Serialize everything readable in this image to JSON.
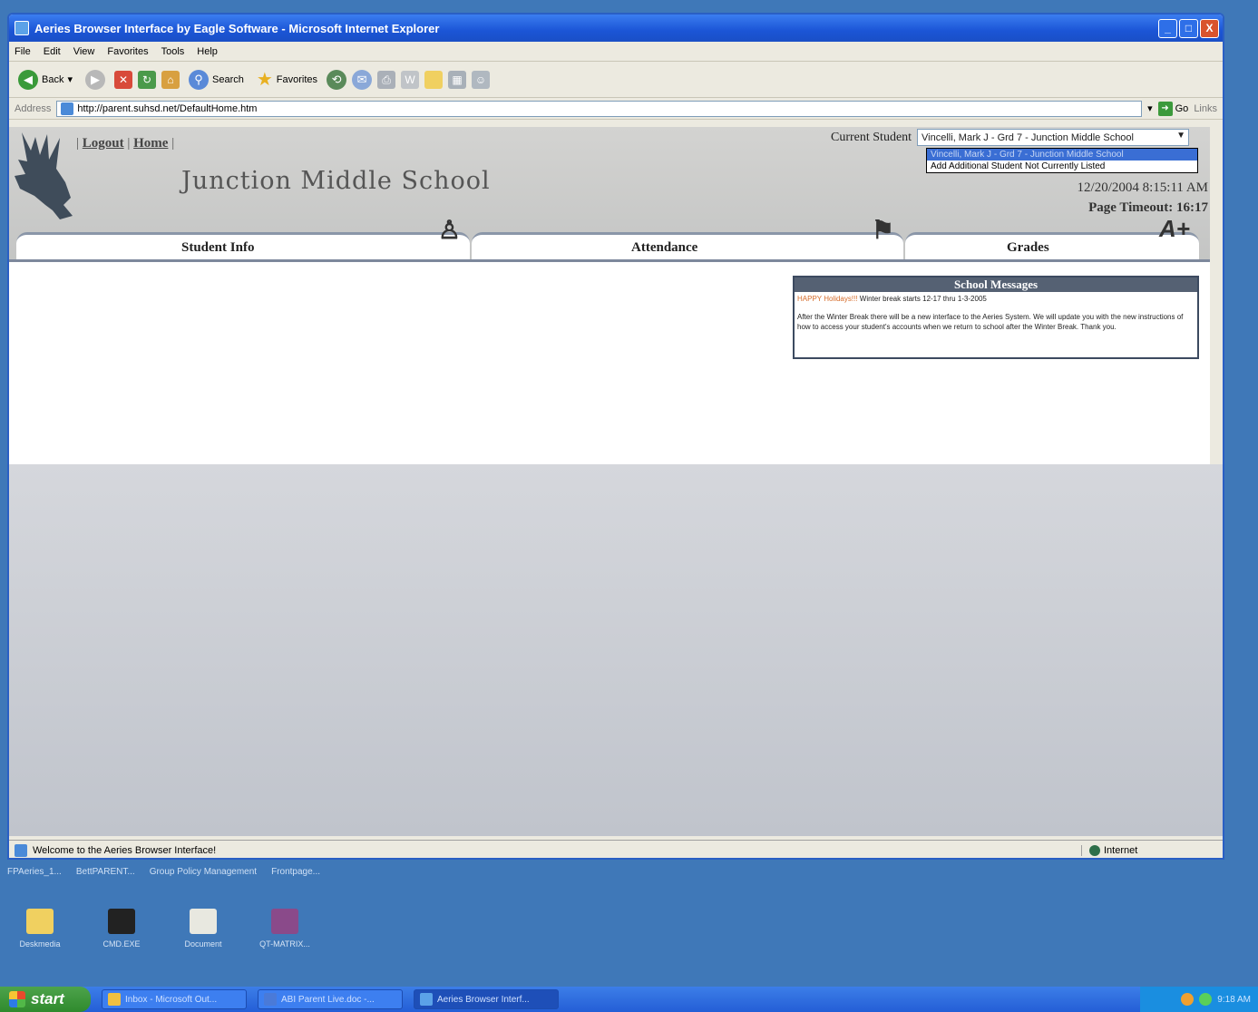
{
  "window": {
    "title": "Aeries Browser Interface by Eagle Software - Microsoft Internet Explorer",
    "buttons": {
      "minimize": "_",
      "maximize": "□",
      "close": "X"
    }
  },
  "menu": [
    "File",
    "Edit",
    "View",
    "Favorites",
    "Tools",
    "Help"
  ],
  "toolbar": {
    "back": "Back",
    "search": "Search",
    "favorites": "Favorites"
  },
  "address": {
    "label": "Address",
    "url": "http://parent.suhsd.net/DefaultHome.htm",
    "go": "Go",
    "links": "Links"
  },
  "page": {
    "logout": "Logout",
    "home": "Home",
    "school_name": "Junction Middle  School",
    "current_student_label": "Current Student",
    "current_student_value": "Vincelli, Mark J - Grd 7 - Junction Middle School",
    "dropdown_options": [
      "Vincelli, Mark J - Grd 7 - Junction Middle School",
      "Add Additional Student Not Currently Listed"
    ],
    "datetime": "12/20/2004 8:15:11 AM",
    "page_timeout_label": "Page Timeout:",
    "page_timeout_value": "16:17",
    "tabs": [
      {
        "label": "Student Info",
        "icon": "student-icon"
      },
      {
        "label": "Attendance",
        "icon": "desk-icon"
      },
      {
        "label": "Grades",
        "icon": "a-plus-icon"
      }
    ],
    "school_messages": {
      "title": "School Messages",
      "highlight": "HAPPY Holidays!!!",
      "line1": " Winter break starts 12-17 thru 1-3-2005",
      "line2": "After the Winter Break there will be a new interface to the Aeries System. We will update you with the new instructions of how to access your student's accounts when we return to school after the Winter Break. Thank you."
    }
  },
  "status": {
    "text": "Welcome to the Aeries Browser Interface!",
    "zone": "Internet"
  },
  "desktop": {
    "top_labels": [
      "FPAeries_1...",
      "BettPARENT...",
      "Group Policy Management",
      "Frontpage..."
    ],
    "icons": [
      "Deskmedia",
      "CMD.EXE",
      "Document",
      "QT-MATRIX..."
    ]
  },
  "taskbar": {
    "start": "start",
    "tasks": [
      "Inbox - Microsoft Out...",
      "ABI Parent Live.doc -...",
      "Aeries Browser Interf..."
    ],
    "clock": "9:18 AM"
  }
}
